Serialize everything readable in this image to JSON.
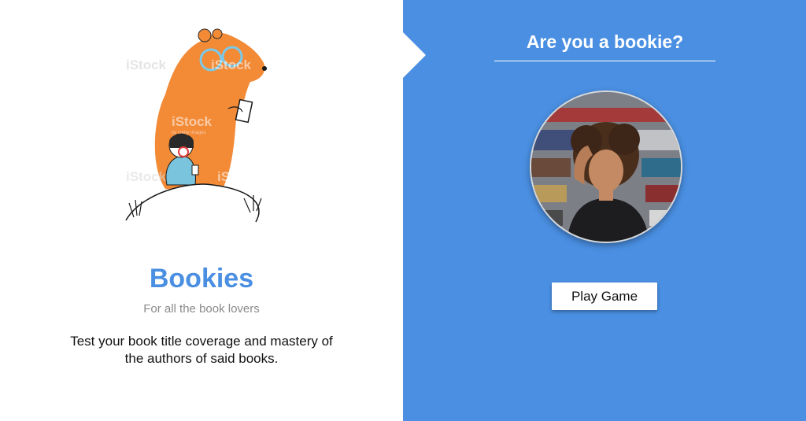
{
  "app": {
    "title": "Bookies",
    "tagline": "For all the book lovers",
    "description": "Test your book title coverage and mastery of the authors of said books."
  },
  "illustration": {
    "icon": "bear-reading-illustration",
    "watermark_text": "iStock",
    "watermark_subtext": "by Getty Images"
  },
  "play_panel": {
    "question": "Are you a bookie?",
    "image_icon": "portrait-photo",
    "button_label": "Play Game"
  },
  "colors": {
    "accent": "#4a8fe2",
    "bear": "#f28a36",
    "text_dark": "#111111",
    "text_muted": "#8a8a8a"
  }
}
